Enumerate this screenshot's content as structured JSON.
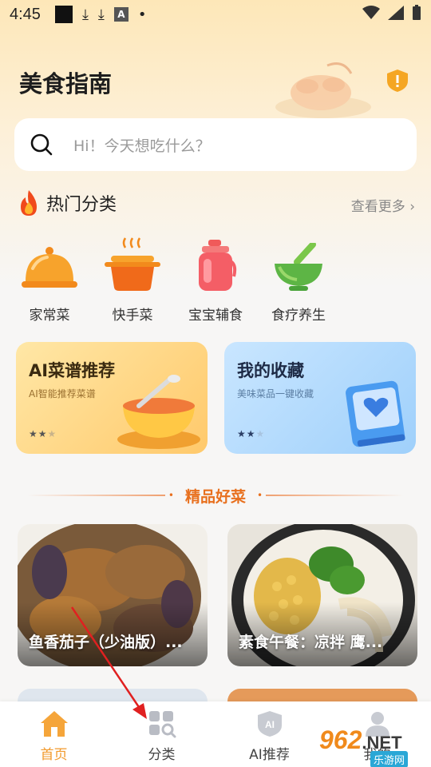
{
  "status_bar": {
    "time": "4:45"
  },
  "header": {
    "title": "美食指南"
  },
  "search": {
    "placeholder": "Hi！今天想吃什么？"
  },
  "hot_categories": {
    "title": "热门分类",
    "see_more": "查看更多",
    "items": [
      {
        "label": "家常菜",
        "icon": "cloche-icon"
      },
      {
        "label": "快手菜",
        "icon": "pot-icon"
      },
      {
        "label": "宝宝辅食",
        "icon": "baby-bottle-icon"
      },
      {
        "label": "食疗养生",
        "icon": "mortar-icon"
      }
    ]
  },
  "promo_cards": [
    {
      "title": "AI菜谱推荐",
      "subtitle": "AI智能推荐菜谱",
      "rating": 2,
      "max_rating": 3
    },
    {
      "title": "我的收藏",
      "subtitle": "美味菜品一键收藏",
      "rating": 2,
      "max_rating": 3
    }
  ],
  "section": {
    "title": "精品好菜"
  },
  "recipes": [
    {
      "name": "鱼香茄子（少油版）..."
    },
    {
      "name": "素食午餐：凉拌 鹰..."
    }
  ],
  "bottom_nav": [
    {
      "label": "首页",
      "icon": "home-icon",
      "active": true
    },
    {
      "label": "分类",
      "icon": "category-icon",
      "active": false
    },
    {
      "label": "AI推荐",
      "icon": "ai-icon",
      "active": false
    },
    {
      "label": "我的",
      "icon": "profile-icon",
      "active": false
    }
  ],
  "watermark": {
    "brand": "962",
    "suffix": ".NET",
    "sub": "乐游网"
  },
  "colors": {
    "accent": "#f29a2c",
    "section": "#e8701e",
    "arrow": "#e02020"
  }
}
